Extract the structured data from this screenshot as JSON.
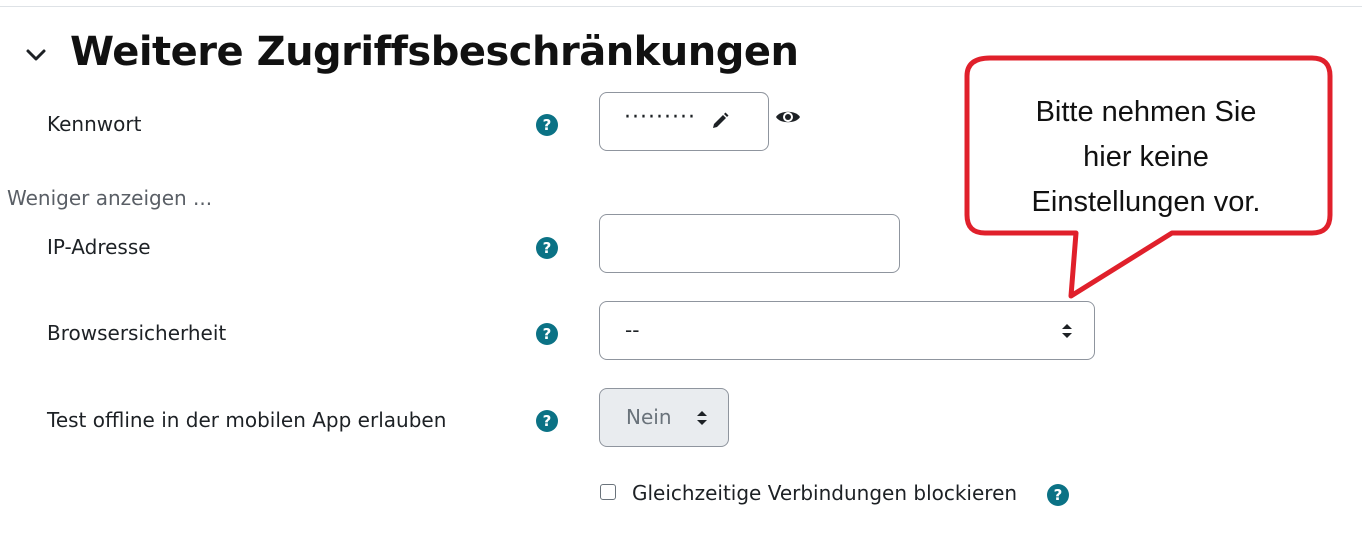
{
  "section": {
    "title": "Weitere Zugriffsbeschränkungen",
    "collapse_icon": "chevron-down-icon"
  },
  "password": {
    "label": "Kennwort",
    "masked_value": "·········",
    "edit_icon": "pencil-icon",
    "reveal_icon": "eye-icon"
  },
  "show_less_link": "Weniger anzeigen ...",
  "ip_address": {
    "label": "IP-Adresse",
    "value": ""
  },
  "browser_security": {
    "label": "Browsersicherheit",
    "selected": "--"
  },
  "offline_test": {
    "label": "Test offline in der mobilen App erlauben",
    "selected": "Nein"
  },
  "block_concurrent": {
    "label": "Gleichzeitige Verbindungen blockieren",
    "checked": false
  },
  "help_icon_glyph": "?",
  "callout": {
    "text": "Bitte nehmen Sie\nhier keine\nEinstellungen vor.",
    "border_color": "#e0202b"
  },
  "colors": {
    "help_icon": "#0b7285",
    "disabled_bg": "#e9ecef"
  }
}
